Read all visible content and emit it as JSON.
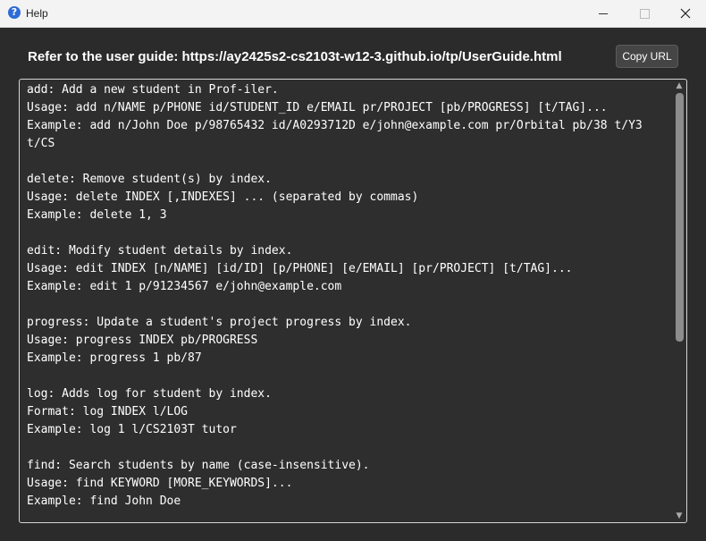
{
  "window": {
    "title": "Help",
    "icon": "help-icon",
    "controls": {
      "minimize": "minimize-icon",
      "maximize": "maximize-icon",
      "close": "close-icon"
    }
  },
  "header": {
    "guide_text": "Refer to the user guide: https://ay2425s2-cs2103t-w12-3.github.io/tp/UserGuide.html",
    "copy_label": "Copy URL"
  },
  "help_text": "add: Add a new student in Prof-iler.\nUsage: add n/NAME p/PHONE id/STUDENT_ID e/EMAIL pr/PROJECT [pb/PROGRESS] [t/TAG]...\nExample: add n/John Doe p/98765432 id/A0293712D e/john@example.com pr/Orbital pb/38 t/Y3\nt/CS\n\ndelete: Remove student(s) by index.\nUsage: delete INDEX [,INDEXES] ... (separated by commas)\nExample: delete 1, 3\n\nedit: Modify student details by index.\nUsage: edit INDEX [n/NAME] [id/ID] [p/PHONE] [e/EMAIL] [pr/PROJECT] [t/TAG]...\nExample: edit 1 p/91234567 e/john@example.com\n\nprogress: Update a student's project progress by index.\nUsage: progress INDEX pb/PROGRESS\nExample: progress 1 pb/87\n\nlog: Adds log for student by index.\nFormat: log INDEX l/LOG\nExample: log 1 l/CS2103T tutor\n\nfind: Search students by name (case-insensitive).\nUsage: find KEYWORD [MORE_KEYWORDS]...\nExample: find John Doe"
}
